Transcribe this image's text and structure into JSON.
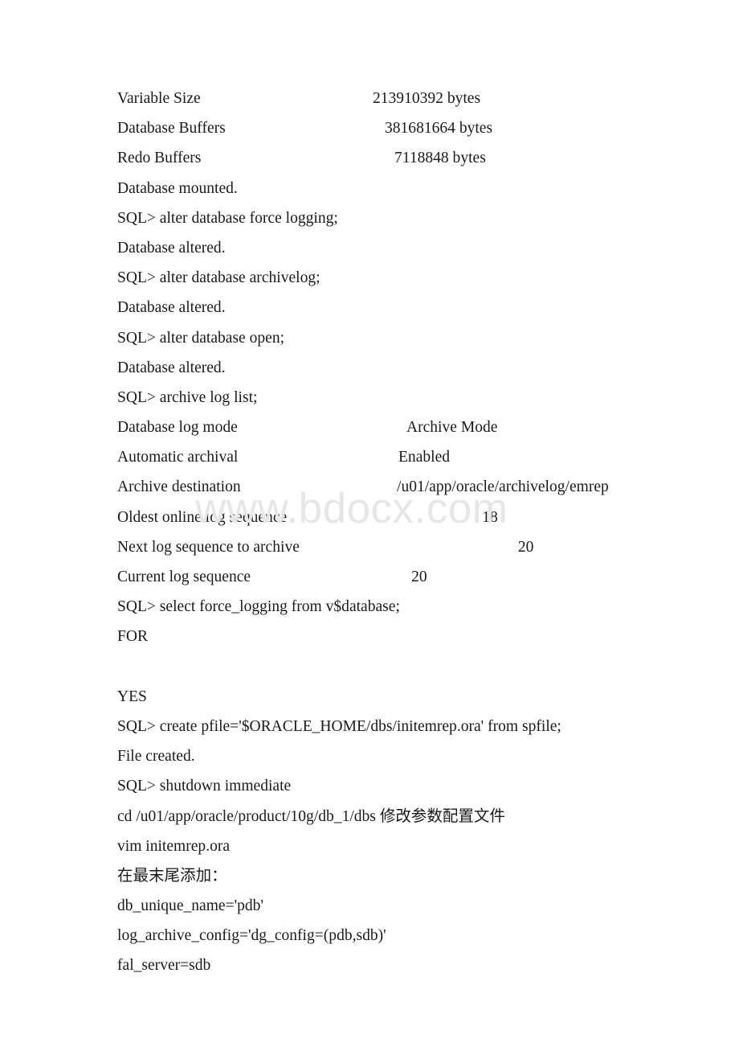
{
  "document": {
    "background_color": "#ffffff",
    "text_color": "#1a1a1a",
    "watermark": {
      "text": "www.bdocx.com",
      "color": "#e6e6e6"
    },
    "lines": [
      {
        "type": "kv",
        "label": "Variable Size",
        "label_w": 158,
        "value": "213910392 bytes",
        "value_x": 160
      },
      {
        "type": "kv",
        "label": "Database Buffers",
        "label_w": 158,
        "value": "381681664 bytes",
        "value_x": 175
      },
      {
        "type": "kv",
        "label": "Redo Buffers",
        "label_w": 158,
        "value": "7118848 bytes",
        "value_x": 187
      },
      {
        "type": "text",
        "text": "Database mounted."
      },
      {
        "type": "text",
        "text": "SQL> alter database force logging;"
      },
      {
        "type": "text",
        "text": "Database altered."
      },
      {
        "type": "text",
        "text": "SQL> alter database archivelog;"
      },
      {
        "type": "text",
        "text": "Database altered."
      },
      {
        "type": "text",
        "text": "SQL> alter database open;"
      },
      {
        "type": "text",
        "text": "Database altered."
      },
      {
        "type": "text",
        "text": "SQL> archive log list;"
      },
      {
        "type": "kv",
        "label": "Database log mode",
        "label_w": 158,
        "value": "Archive Mode",
        "value_x": 202
      },
      {
        "type": "kv",
        "label": "Automatic archival",
        "label_w": 158,
        "value": "Enabled",
        "value_x": 192
      },
      {
        "type": "kv",
        "label": "Archive destination",
        "label_w": 158,
        "value": "/u01/app/oracle/archivelog/emrep",
        "value_x": 190
      },
      {
        "type": "kv",
        "label": "Oldest online log sequence",
        "label_w": 158,
        "value": "18",
        "value_x": 243
      },
      {
        "type": "kv",
        "label": "Next log sequence to archive",
        "label_w": 158,
        "value": "20",
        "value_x": 272
      },
      {
        "type": "kv",
        "label": "Current log sequence",
        "label_w": 158,
        "value": "20",
        "value_x": 200
      },
      {
        "type": "text",
        "text": "SQL> select force_logging from v$database;"
      },
      {
        "type": "text",
        "text": "FOR"
      },
      {
        "type": "blank",
        "text": ""
      },
      {
        "type": "text",
        "text": "YES"
      },
      {
        "type": "text",
        "text": "SQL> create pfile='$ORACLE_HOME/dbs/initemrep.ora' from spfile;"
      },
      {
        "type": "text",
        "text": "File created."
      },
      {
        "type": "text",
        "text": "SQL> shutdown immediate"
      },
      {
        "type": "text",
        "text": "cd /u01/app/oracle/product/10g/db_1/dbs 修改参数配置文件"
      },
      {
        "type": "text",
        "text": "vim initemrep.ora"
      },
      {
        "type": "text",
        "text": "在最末尾添加："
      },
      {
        "type": "text",
        "text": "db_unique_name='pdb'"
      },
      {
        "type": "text",
        "text": "log_archive_config='dg_config=(pdb,sdb)'"
      },
      {
        "type": "text",
        "text": "fal_server=sdb"
      }
    ]
  }
}
